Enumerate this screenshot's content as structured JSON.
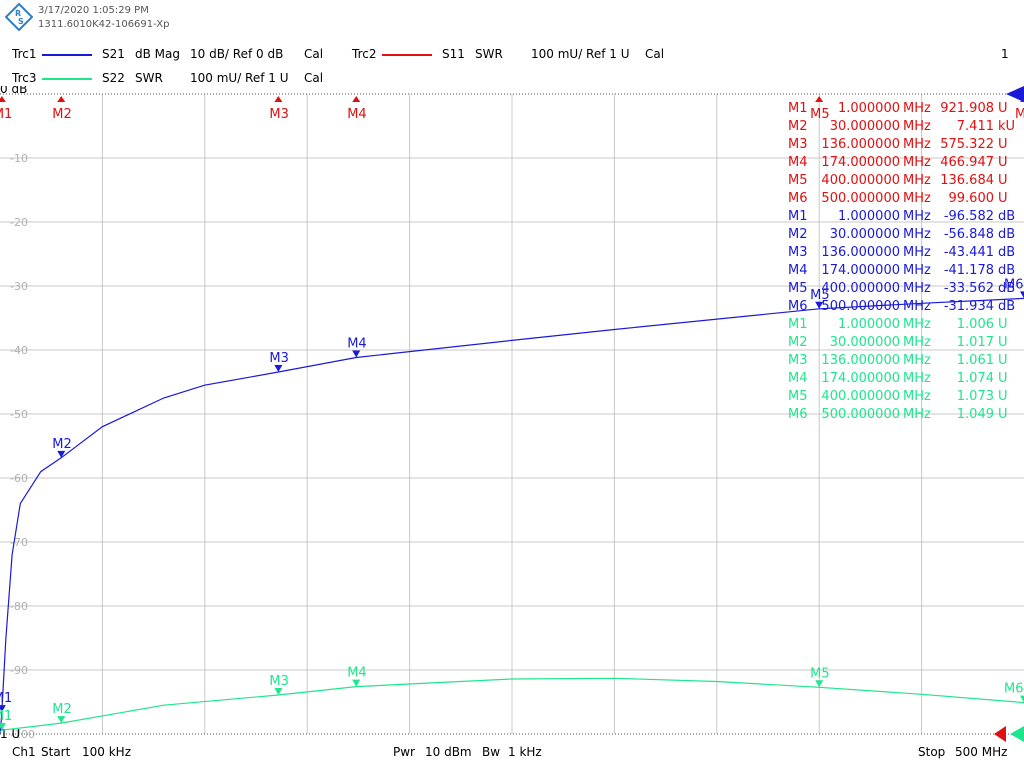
{
  "header": {
    "timestamp": "3/17/2020 1:05:29 PM",
    "instrument_id": "1311.6010K42-106691-Xp",
    "window_number": "1"
  },
  "traces": [
    {
      "id": "Trc1",
      "param": "S21",
      "format": "dB Mag",
      "scale": "10 dB/ Ref 0 dB",
      "cal": "Cal",
      "color": "#1a1ad8"
    },
    {
      "id": "Trc2",
      "param": "S11",
      "format": "SWR",
      "scale": "100 mU/ Ref 1 U",
      "cal": "Cal",
      "color": "#e01010"
    },
    {
      "id": "Trc3",
      "param": "S22",
      "format": "SWR",
      "scale": "100 mU/ Ref 1 U",
      "cal": "Cal",
      "color": "#1ee68c"
    }
  ],
  "footer": {
    "channel": "Ch1",
    "start_label": "Start",
    "start_value": "100 kHz",
    "power_label": "Pwr",
    "power_value": "10 dBm",
    "bw_label": "Bw",
    "bw_value": "1 kHz",
    "stop_label": "Stop",
    "stop_value": "500 MHz"
  },
  "axis": {
    "top_label": "0 dB",
    "bottom_label": "1 U",
    "y_ticks": [
      "-10",
      "-20",
      "-30",
      "-40",
      "-50",
      "-60",
      "-70",
      "-80",
      "-90",
      "-100"
    ]
  },
  "chart_data": {
    "type": "line",
    "x_range_mhz": [
      0.1,
      500
    ],
    "ylim_db": [
      -100,
      0
    ],
    "ylim_swr": [
      1.0,
      2.0
    ],
    "grid": true,
    "series": [
      {
        "name": "Trc1 S21 dB Mag",
        "unit": "dB",
        "x_mhz": [
          0.1,
          0.5,
          1,
          3,
          6,
          10,
          20,
          30,
          50,
          80,
          100,
          136,
          174,
          250,
          300,
          400,
          450,
          500
        ],
        "y": [
          -100,
          -99,
          -96.582,
          -85,
          -72,
          -64,
          -59,
          -56.848,
          -52,
          -47.5,
          -45.5,
          -43.441,
          -41.178,
          -38.5,
          -36.8,
          -33.562,
          -32.7,
          -31.934
        ]
      },
      {
        "name": "Trc3 S22 SWR",
        "unit": "U",
        "x_mhz": [
          0.1,
          1,
          30,
          80,
          136,
          174,
          250,
          300,
          350,
          400,
          450,
          500
        ],
        "y": [
          1.003,
          1.006,
          1.017,
          1.045,
          1.061,
          1.074,
          1.086,
          1.087,
          1.082,
          1.073,
          1.062,
          1.049
        ]
      }
    ]
  },
  "markers_trc2": [
    {
      "id": "M1",
      "x": "1.000000",
      "unit_x": "MHz",
      "value": "921.908",
      "unit": "U"
    },
    {
      "id": "M2",
      "x": "30.000000",
      "unit_x": "MHz",
      "value": "7.411",
      "unit": "kU"
    },
    {
      "id": "M3",
      "x": "136.000000",
      "unit_x": "MHz",
      "value": "575.322",
      "unit": "U"
    },
    {
      "id": "M4",
      "x": "174.000000",
      "unit_x": "MHz",
      "value": "466.947",
      "unit": "U"
    },
    {
      "id": "M5",
      "x": "400.000000",
      "unit_x": "MHz",
      "value": "136.684",
      "unit": "U"
    },
    {
      "id": "M6",
      "x": "500.000000",
      "unit_x": "MHz",
      "value": "99.600",
      "unit": "U"
    }
  ],
  "markers_trc1": [
    {
      "id": "M1",
      "x": "1.000000",
      "unit_x": "MHz",
      "value": "-96.582",
      "unit": "dB"
    },
    {
      "id": "M2",
      "x": "30.000000",
      "unit_x": "MHz",
      "value": "-56.848",
      "unit": "dB"
    },
    {
      "id": "M3",
      "x": "136.000000",
      "unit_x": "MHz",
      "value": "-43.441",
      "unit": "dB"
    },
    {
      "id": "M4",
      "x": "174.000000",
      "unit_x": "MHz",
      "value": "-41.178",
      "unit": "dB"
    },
    {
      "id": "M5",
      "x": "400.000000",
      "unit_x": "MHz",
      "value": "-33.562",
      "unit": "dB"
    },
    {
      "id": "M6",
      "x": "500.000000",
      "unit_x": "MHz",
      "value": "-31.934",
      "unit": "dB"
    }
  ],
  "markers_trc3": [
    {
      "id": "M1",
      "x": "1.000000",
      "unit_x": "MHz",
      "value": "1.006",
      "unit": "U"
    },
    {
      "id": "M2",
      "x": "30.000000",
      "unit_x": "MHz",
      "value": "1.017",
      "unit": "U"
    },
    {
      "id": "M3",
      "x": "136.000000",
      "unit_x": "MHz",
      "value": "1.061",
      "unit": "U"
    },
    {
      "id": "M4",
      "x": "174.000000",
      "unit_x": "MHz",
      "value": "1.074",
      "unit": "U"
    },
    {
      "id": "M5",
      "x": "400.000000",
      "unit_x": "MHz",
      "value": "1.073",
      "unit": "U"
    },
    {
      "id": "M6",
      "x": "500.000000",
      "unit_x": "MHz",
      "value": "1.049",
      "unit": "U"
    }
  ],
  "colors": {
    "grid": "#c8c8c8",
    "trc1": "#1a1ad8",
    "trc2": "#e01010",
    "trc3": "#1ee68c"
  }
}
